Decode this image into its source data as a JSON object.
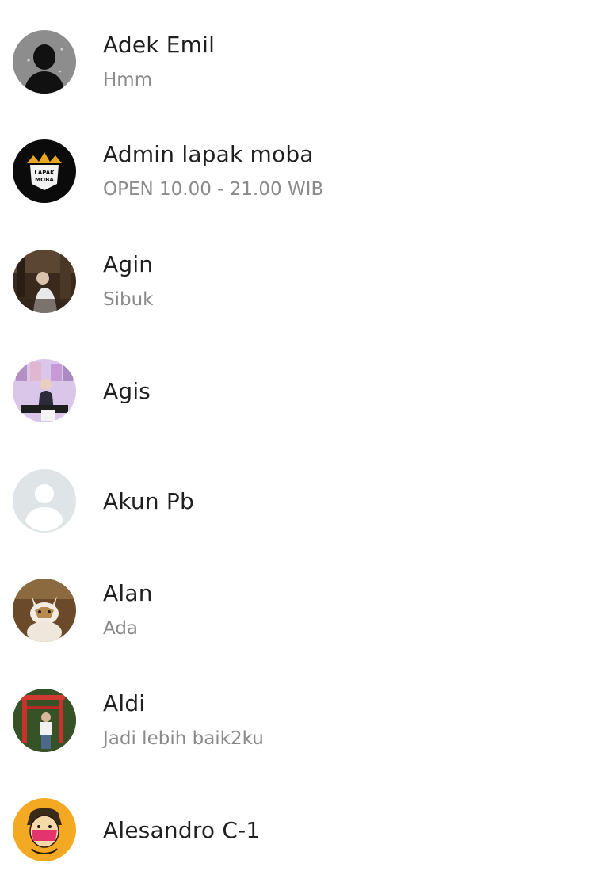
{
  "contacts": [
    {
      "name": "Adek Emil",
      "status": "Hmm",
      "avatar_icon": "dark-silhouette-avatar"
    },
    {
      "name": "Admin lapak moba",
      "status": "OPEN 10.00 - 21.00 WIB",
      "avatar_icon": "lapak-moba-logo-avatar",
      "logo_text": "LAPAK MOBA"
    },
    {
      "name": "Agin",
      "status": "Sibuk",
      "avatar_icon": "photo-avatar"
    },
    {
      "name": "Agis",
      "status": "",
      "avatar_icon": "photo-avatar"
    },
    {
      "name": "Akun Pb",
      "status": "",
      "avatar_icon": "default-person-avatar"
    },
    {
      "name": "Alan",
      "status": "Ada",
      "avatar_icon": "cat-photo-avatar"
    },
    {
      "name": "Aldi",
      "status": "Jadi lebih baik2ku",
      "avatar_icon": "photo-avatar"
    },
    {
      "name": "Alesandro C-1",
      "status": "",
      "avatar_icon": "illustration-avatar"
    }
  ]
}
